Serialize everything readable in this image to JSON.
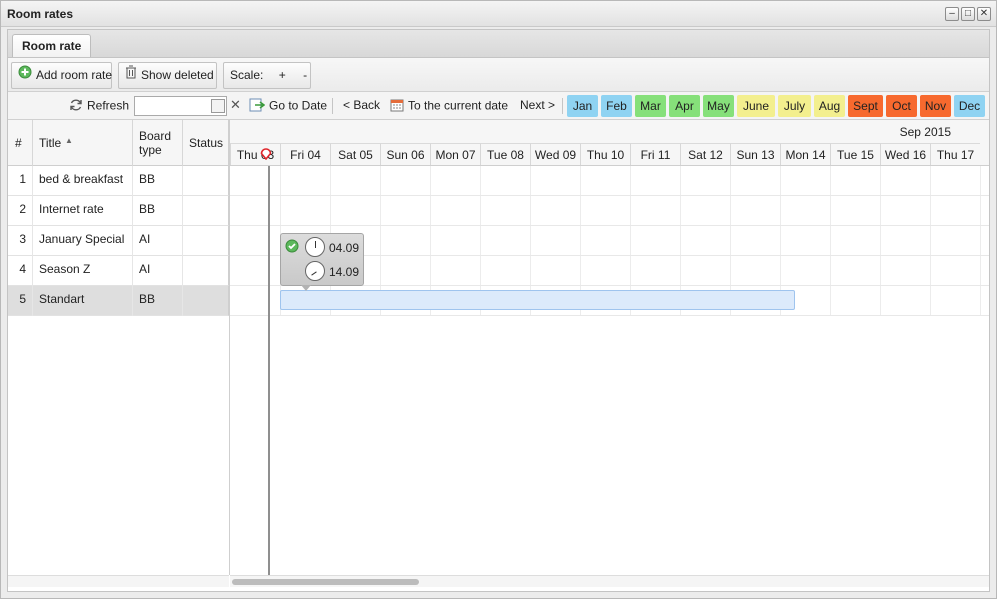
{
  "window": {
    "title": "Room rates"
  },
  "tabs": [
    {
      "label": "Room rate"
    }
  ],
  "toolbar": {
    "add_label": "Add room rate",
    "show_deleted_label": "Show deleted",
    "scale_label": "Scale:",
    "zoom_in": "+",
    "zoom_out": "-"
  },
  "nav": {
    "refresh": "Refresh",
    "date_value": "",
    "clear": "✕",
    "go_to_date": "Go to Date",
    "back": "< Back",
    "current_date": "To the current date",
    "next": "Next >"
  },
  "months": [
    {
      "label": "Jan",
      "color": "#8fd3f2"
    },
    {
      "label": "Feb",
      "color": "#8fd3f2"
    },
    {
      "label": "Mar",
      "color": "#86e07a"
    },
    {
      "label": "Apr",
      "color": "#86e07a"
    },
    {
      "label": "May",
      "color": "#86e07a"
    },
    {
      "label": "June",
      "color": "#f3ef8e"
    },
    {
      "label": "July",
      "color": "#f3ef8e"
    },
    {
      "label": "Aug",
      "color": "#f3ef8e"
    },
    {
      "label": "Sept",
      "color": "#f7692e"
    },
    {
      "label": "Oct",
      "color": "#f7692e"
    },
    {
      "label": "Nov",
      "color": "#f7692e"
    },
    {
      "label": "Dec",
      "color": "#8fd3f2"
    }
  ],
  "grid": {
    "columns": {
      "num": "#",
      "title": "Title",
      "board": "Board type",
      "status": "Status"
    },
    "rows": [
      {
        "num": "1",
        "title": "bed & breakfast",
        "board": "BB",
        "status": ""
      },
      {
        "num": "2",
        "title": "Internet rate",
        "board": "BB",
        "status": ""
      },
      {
        "num": "3",
        "title": "January Special",
        "board": "AI",
        "status": ""
      },
      {
        "num": "4",
        "title": "Season Z",
        "board": "AI",
        "status": ""
      },
      {
        "num": "5",
        "title": "Standart",
        "board": "BB",
        "status": ""
      }
    ]
  },
  "timeline": {
    "month_label": "Sep 2015",
    "days": [
      "Thu 03",
      "Fri 04",
      "Sat 05",
      "Sun 06",
      "Mon 07",
      "Tue 08",
      "Wed 09",
      "Thu 10",
      "Fri 11",
      "Sat 12",
      "Sun 13",
      "Mon 14",
      "Tue 15",
      "Wed 16",
      "Thu 17"
    ],
    "tooltip": {
      "start": "04.09",
      "end": "14.09"
    }
  }
}
